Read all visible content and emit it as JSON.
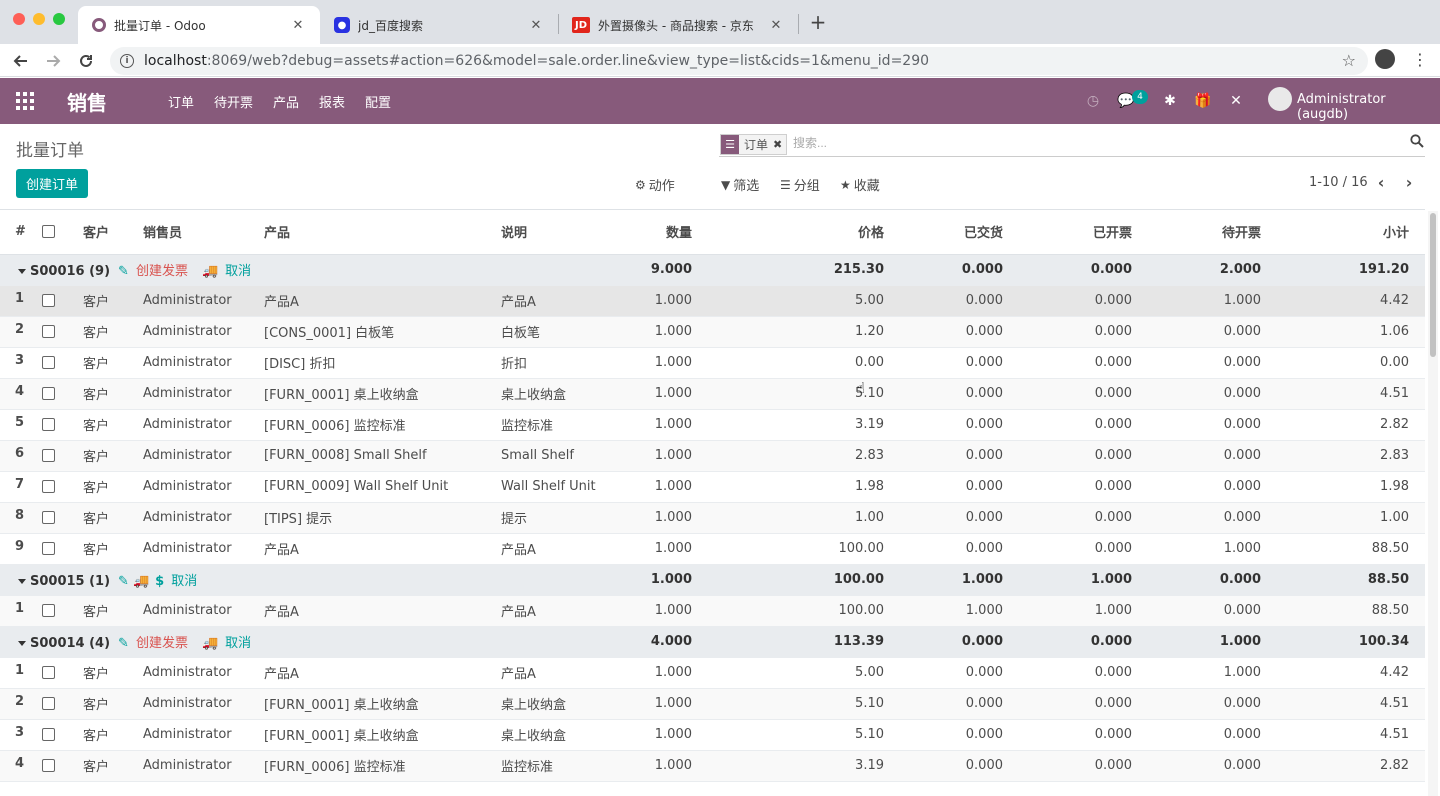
{
  "browser": {
    "tabs": [
      {
        "title": "批量订单 - Odoo",
        "favicon": "odoo-icon"
      },
      {
        "title": "jd_百度搜索",
        "favicon": "baidu-icon"
      },
      {
        "title": "外置摄像头 - 商品搜索 - 京东",
        "favicon": "jd-icon",
        "favicon_text": "JD"
      }
    ],
    "close_glyph": "✕",
    "new_tab": "+",
    "url_host": "localhost",
    "url_path": ":8069/web?debug=assets#action=626&model=sale.order.line&view_type=list&cids=1&menu_id=290"
  },
  "navbar": {
    "brand": "销售",
    "menus": [
      "订单",
      "待开票",
      "产品",
      "报表",
      "配置"
    ],
    "chat_count": "4",
    "user": "Administrator (augdb)"
  },
  "control_panel": {
    "breadcrumb": "批量订单",
    "create_label": "创建订单",
    "facet_label": "订单",
    "search_placeholder": "搜索...",
    "actions_label": "动作",
    "filter_label": "筛选",
    "group_label": "分组",
    "favorites_label": "收藏",
    "pager": "1-10 / 16"
  },
  "table": {
    "headers": [
      "#",
      "客户",
      "销售员",
      "产品",
      "说明",
      "数量",
      "价格",
      "已交货",
      "已开票",
      "待开票",
      "小计"
    ],
    "groups": [
      {
        "name": "S00016 (9)",
        "actions": {
          "invoice": "创建发票",
          "cancel": "取消"
        },
        "totals": [
          "9.000",
          "215.30",
          "0.000",
          "0.000",
          "2.000",
          "191.20"
        ],
        "rows": [
          [
            "1",
            "客户",
            "Administrator",
            "产品A",
            "产品A",
            "1.000",
            "5.00",
            "0.000",
            "0.000",
            "1.000",
            "4.42"
          ],
          [
            "2",
            "客户",
            "Administrator",
            "[CONS_0001] 白板笔",
            "白板笔",
            "1.000",
            "1.20",
            "0.000",
            "0.000",
            "0.000",
            "1.06"
          ],
          [
            "3",
            "客户",
            "Administrator",
            "[DISC] 折扣",
            "折扣",
            "1.000",
            "0.00",
            "0.000",
            "0.000",
            "0.000",
            "0.00"
          ],
          [
            "4",
            "客户",
            "Administrator",
            "[FURN_0001] 桌上收纳盒",
            "桌上收纳盒",
            "1.000",
            "5.10",
            "0.000",
            "0.000",
            "0.000",
            "4.51"
          ],
          [
            "5",
            "客户",
            "Administrator",
            "[FURN_0006] 监控标准",
            "监控标准",
            "1.000",
            "3.19",
            "0.000",
            "0.000",
            "0.000",
            "2.82"
          ],
          [
            "6",
            "客户",
            "Administrator",
            "[FURN_0008] Small Shelf",
            "Small Shelf",
            "1.000",
            "2.83",
            "0.000",
            "0.000",
            "0.000",
            "2.83"
          ],
          [
            "7",
            "客户",
            "Administrator",
            "[FURN_0009] Wall Shelf Unit",
            "Wall Shelf Unit",
            "1.000",
            "1.98",
            "0.000",
            "0.000",
            "0.000",
            "1.98"
          ],
          [
            "8",
            "客户",
            "Administrator",
            "[TIPS] 提示",
            "提示",
            "1.000",
            "1.00",
            "0.000",
            "0.000",
            "0.000",
            "1.00"
          ],
          [
            "9",
            "客户",
            "Administrator",
            "产品A",
            "产品A",
            "1.000",
            "100.00",
            "0.000",
            "0.000",
            "1.000",
            "88.50"
          ]
        ]
      },
      {
        "name": "S00015 (1)",
        "actions": {
          "dollar": "$",
          "cancel": "取消"
        },
        "totals": [
          "1.000",
          "100.00",
          "1.000",
          "1.000",
          "0.000",
          "88.50"
        ],
        "rows": [
          [
            "1",
            "客户",
            "Administrator",
            "产品A",
            "产品A",
            "1.000",
            "100.00",
            "1.000",
            "1.000",
            "0.000",
            "88.50"
          ]
        ]
      },
      {
        "name": "S00014 (4)",
        "actions": {
          "invoice": "创建发票",
          "cancel": "取消"
        },
        "totals": [
          "4.000",
          "113.39",
          "0.000",
          "0.000",
          "1.000",
          "100.34"
        ],
        "rows": [
          [
            "1",
            "客户",
            "Administrator",
            "产品A",
            "产品A",
            "1.000",
            "5.00",
            "0.000",
            "0.000",
            "1.000",
            "4.42"
          ],
          [
            "2",
            "客户",
            "Administrator",
            "[FURN_0001] 桌上收纳盒",
            "桌上收纳盒",
            "1.000",
            "5.10",
            "0.000",
            "0.000",
            "0.000",
            "4.51"
          ],
          [
            "3",
            "客户",
            "Administrator",
            "[FURN_0001] 桌上收纳盒",
            "桌上收纳盒",
            "1.000",
            "5.10",
            "0.000",
            "0.000",
            "0.000",
            "4.51"
          ],
          [
            "4",
            "客户",
            "Administrator",
            "[FURN_0006] 监控标准",
            "监控标准",
            "1.000",
            "3.19",
            "0.000",
            "0.000",
            "0.000",
            "2.82"
          ]
        ]
      }
    ]
  },
  "colors": {
    "brand_purple": "#875a7b",
    "primary_teal": "#00a09d",
    "invoice_red": "#d9534f"
  }
}
